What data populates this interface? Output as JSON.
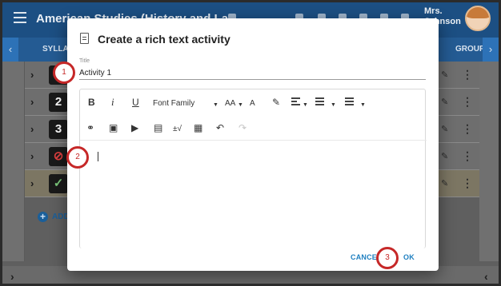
{
  "app": {
    "course_title": "American Studies (History and La",
    "user_name_line1": "Mrs.",
    "user_name_line2": "Johnson"
  },
  "tabs": {
    "left_label": "SYLLA",
    "right_label": "GROUP"
  },
  "list": {
    "rows": [
      {
        "badge": "1",
        "selected": false
      },
      {
        "badge": "2",
        "selected": false
      },
      {
        "badge": "3",
        "selected": false
      },
      {
        "badge": "⊘",
        "selected": false
      },
      {
        "badge": "✓",
        "selected": true
      }
    ],
    "add_label": "ADD"
  },
  "dialog": {
    "title": "Create a rich text activity",
    "field_label": "Title",
    "field_value": "Activity 1",
    "font_family_label": "Font Family",
    "cancel_label": "CANCEL",
    "ok_label": "OK"
  },
  "callouts": [
    "1",
    "2",
    "3"
  ],
  "colors": {
    "primary": "#1c4f83",
    "accent_button": "#1e7fc0",
    "callout": "#c62828"
  }
}
